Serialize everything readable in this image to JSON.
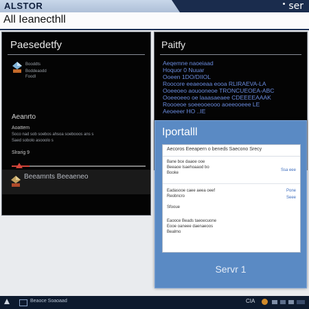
{
  "app": {
    "brand": "ALSTOR",
    "top_right": "ser",
    "page_title": "All Ieanecthll"
  },
  "left_panel": {
    "title": "Paesedetfy",
    "thumb_lines": [
      "Booddts",
      "Boddeaodd",
      "Foodl"
    ],
    "section_heading": "Aeanrto",
    "section_subtitle": "Aoattem",
    "section_lines": [
      "Soco nad sob soebos ahsoa soebooos ans s",
      "Saed sobolo asooolo s"
    ],
    "slider_label": "Slrarig  9",
    "row_label": "Beeamnts  Beeaeneo"
  },
  "right_panel": {
    "title": "Paitfy",
    "lines": [
      "Aeqemne naoeiaad",
      "Hoquor  0   Nuuar",
      "Ooeen  1DO/DIIOL",
      "Roocore eeaeoeaa eooa  RLIRAEVA-LA",
      "Ooeeoeo aouooneoe  TRONCUEOEA-ABC",
      "Ooeeoeeo oe laaasaeaee  CDEEEEAAAK",
      "Roooeoe soeeooeooo  aoeeooeee  LE",
      "Aeoeeer  HO  ..IE"
    ]
  },
  "dialog": {
    "title": "Iportalll",
    "card_header": "Aecoros Eeeapern o beneds Saecono Srecy",
    "block1": [
      "Bane bce daaoe ooe",
      "Beeaoe lsaehoaaod bo",
      "Booke"
    ],
    "block1_link": "Ssa eee",
    "block2": [
      "Eadasooe caee aeea oeef",
      "Reobncro",
      "",
      "Sfooue"
    ],
    "block2_links": [
      "Pone  ",
      "Seee"
    ],
    "block3": [
      "Eaooce Beads taeoecuone",
      "Eooe  oaneee daenaeoos",
      "Bealmo"
    ],
    "button": "Servr 1"
  },
  "taskbar": {
    "item_label": "Beaoce  Soaoaad",
    "lang": "CIA"
  }
}
